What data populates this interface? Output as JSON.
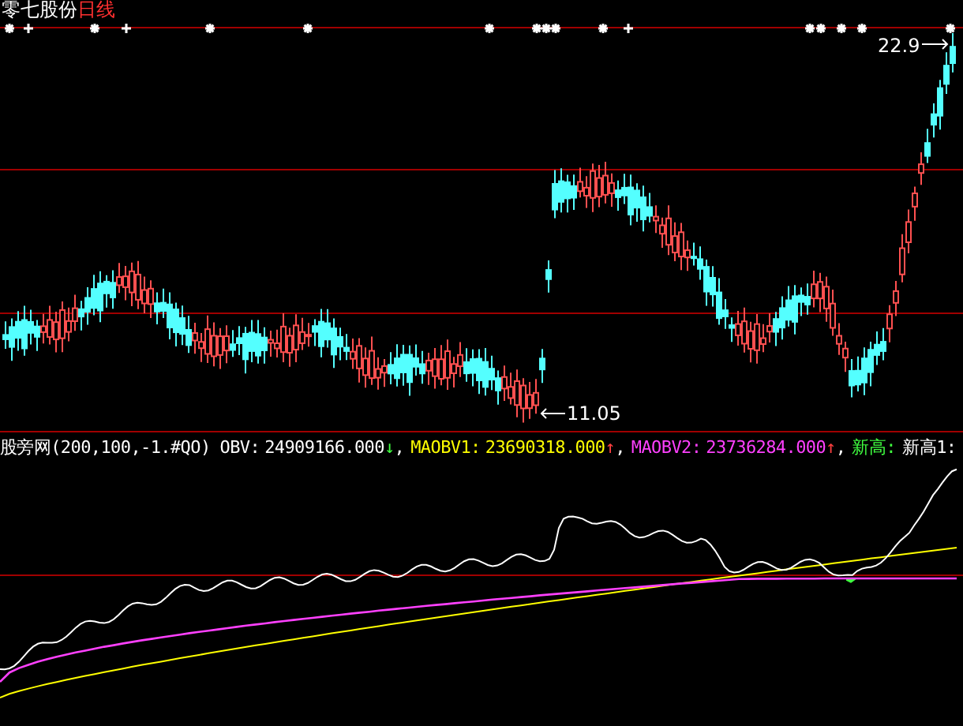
{
  "title": {
    "stock": "零七股份",
    "period": "日线"
  },
  "price_labels": {
    "low": "11.05",
    "high": "22.9"
  },
  "indicator": {
    "name": "股旁网",
    "params": "(200,100,-1.#QO)",
    "series": [
      {
        "label": "OBV:",
        "value": "24909166.000",
        "arrow": {
          "text": "↓",
          "color": "#40ff40"
        },
        "separator": ",",
        "color": "#ffffff"
      },
      {
        "label": "MAOBV1:",
        "value": "23690318.000",
        "arrow": {
          "text": "↑",
          "color": "#ff4040"
        },
        "separator": ",",
        "color": "#ffff00"
      },
      {
        "label": "MAOBV2:",
        "value": "23736284.000",
        "arrow": {
          "text": "↑",
          "color": "#ff4040"
        },
        "separator": ",",
        "color": "#ff40ff"
      },
      {
        "label": "新高:",
        "color": "#40ff40"
      },
      {
        "label": "新高1:",
        "color": "#ffffff"
      }
    ]
  }
}
